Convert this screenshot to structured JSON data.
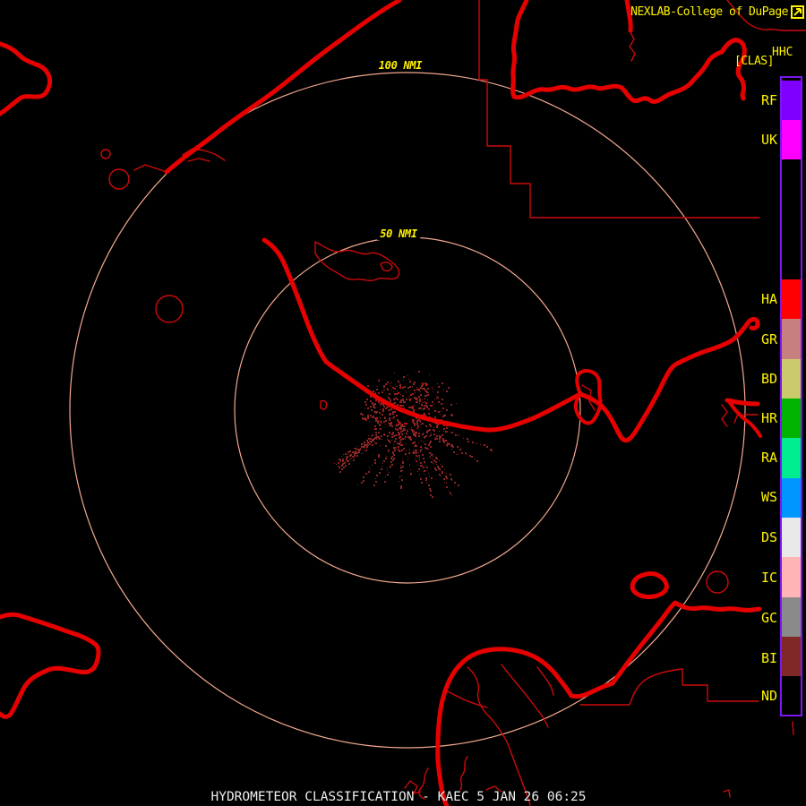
{
  "header": {
    "brand": "NEXLAB-College of DuPage",
    "product_code": "HHC",
    "product_tag": "[CLAS]"
  },
  "rings": [
    {
      "label": "100 NMI"
    },
    {
      "label": "50 NMI"
    }
  ],
  "legend": {
    "categories": [
      {
        "code": "RF",
        "color": "#8000FF"
      },
      {
        "code": "UK",
        "color": "#FF00FF"
      },
      {
        "code": "HA",
        "color": "#FF0000"
      },
      {
        "code": "GR",
        "color": "#C87F7F"
      },
      {
        "code": "BD",
        "color": "#CCCB6C"
      },
      {
        "code": "HR",
        "color": "#00B300"
      },
      {
        "code": "RA",
        "color": "#00EE90"
      },
      {
        "code": "WS",
        "color": "#0096FF"
      },
      {
        "code": "DS",
        "color": "#E9E9E9"
      },
      {
        "code": "IC",
        "color": "#FFB5B5"
      },
      {
        "code": "GC",
        "color": "#8A8A8A"
      },
      {
        "code": "BI",
        "color": "#802828"
      },
      {
        "code": "ND",
        "color": "#000000"
      }
    ]
  },
  "status_bar": {
    "product": "HYDROMETEOR CLASSIFICATION",
    "station": "KAEC",
    "datetime": "5 JAN 26 06:25",
    "text": "HYDROMETEOR CLASSIFICATION - KAEC 5 JAN 26 06:25"
  },
  "colors": {
    "ring": "#F3A98F",
    "map_line_thick": "#E60000",
    "map_line_thin": "#CE0A0A",
    "echo_speckle": "#8B2424",
    "label_yellow": "#FFF200",
    "status_text": "#EDEDED",
    "legend_border": "#7C16F0"
  }
}
